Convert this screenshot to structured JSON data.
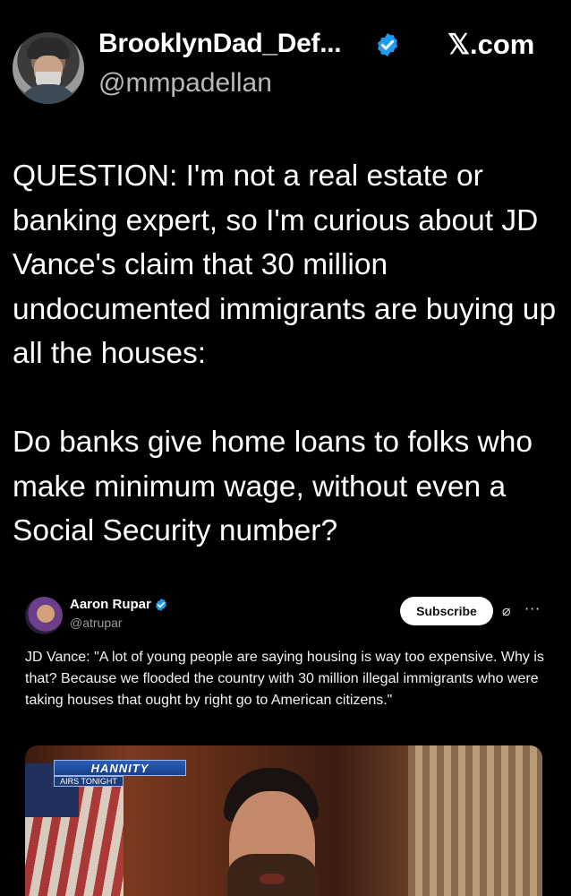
{
  "author": {
    "display_name": "BrooklynDad_Def...",
    "handle": "@mmpadellan",
    "verified_icon": "verified-badge-icon",
    "avatar_icon": "user-avatar"
  },
  "source": {
    "site": "𝕏.com"
  },
  "tweet": {
    "paragraphs": [
      "QUESTION: I'm not a real estate or banking expert, so I'm curious about JD Vance's claim that 30 million undocumented immigrants are buying up all the houses:",
      "Do banks give home loans to folks who make minimum wage, without even a Social Security number?"
    ]
  },
  "quoted": {
    "name": "Aaron Rupar",
    "handle": "@atrupar",
    "subscribe_label": "Subscribe",
    "grok_icon": "⌀",
    "more_icon": "···",
    "text": "JD Vance: \"A lot of young people are saying housing is way too expensive. Why is that? Because we flooded the country with 30 million illegal immigrants who were taking houses that ought by right go to American citizens.\"",
    "video": {
      "show_title": "HANNITY",
      "show_subtitle": "AIRS TONIGHT"
    }
  },
  "colors": {
    "background": "#000000",
    "verified": "#1d9bf0",
    "handle_gray": "#b9b9b9"
  }
}
